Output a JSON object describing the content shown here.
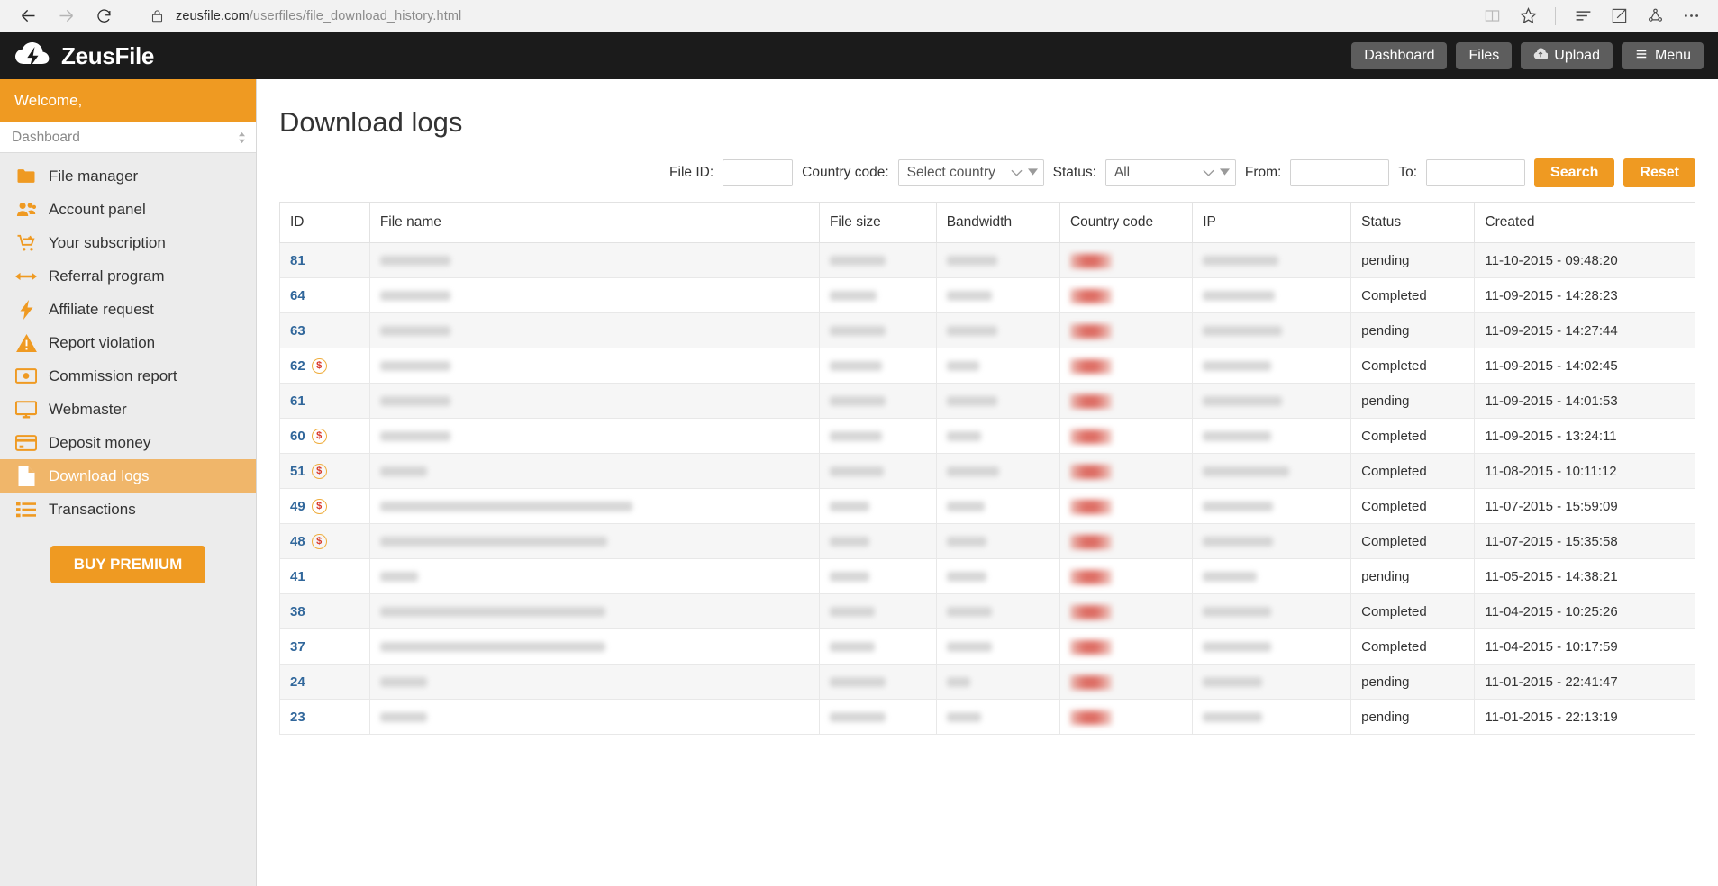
{
  "browser": {
    "url_host": "zeusfile.com",
    "url_path": "/userfiles/file_download_history.html",
    "back_icon": "back-arrow-icon",
    "forward_icon": "forward-arrow-icon",
    "refresh_icon": "refresh-icon",
    "lock_icon": "lock-icon",
    "reading_view_icon": "book-icon",
    "favorites_icon": "star-icon",
    "hub_icon": "hub-lines-icon",
    "note_icon": "note-edit-icon",
    "share_icon": "share-icon",
    "more_icon": "more-ellipsis-icon"
  },
  "header": {
    "brand": "ZeusFile",
    "logo_icon": "cloud-lightning-icon",
    "nav": [
      {
        "label": "Dashboard",
        "icon": ""
      },
      {
        "label": "Files",
        "icon": ""
      },
      {
        "label": "Upload",
        "icon": "cloud-upload-icon"
      },
      {
        "label": "Menu",
        "icon": "hamburger-icon"
      }
    ]
  },
  "sidebar": {
    "welcome": "Welcome,",
    "dashboard_select": "Dashboard",
    "items": [
      {
        "label": "File manager",
        "icon": "folder-icon",
        "active": false
      },
      {
        "label": "Account panel",
        "icon": "users-icon",
        "active": false
      },
      {
        "label": "Your subscription",
        "icon": "cart-plus-icon",
        "active": false
      },
      {
        "label": "Referral program",
        "icon": "arrows-icon",
        "active": false
      },
      {
        "label": "Affiliate request",
        "icon": "bolt-icon",
        "active": false
      },
      {
        "label": "Report violation",
        "icon": "warning-icon",
        "active": false
      },
      {
        "label": "Commission report",
        "icon": "banknote-icon",
        "active": false
      },
      {
        "label": "Webmaster",
        "icon": "monitor-icon",
        "active": false
      },
      {
        "label": "Deposit money",
        "icon": "credit-card-icon",
        "active": false
      },
      {
        "label": "Download logs",
        "icon": "document-icon",
        "active": true
      },
      {
        "label": "Transactions",
        "icon": "list-icon",
        "active": false
      }
    ],
    "buy_premium": "BUY PREMIUM"
  },
  "main": {
    "title": "Download logs",
    "filters": {
      "file_id_label": "File ID:",
      "file_id_value": "",
      "country_label": "Country code:",
      "country_value": "Select country",
      "status_label": "Status:",
      "status_value": "All",
      "from_label": "From:",
      "from_value": "",
      "to_label": "To:",
      "to_value": "",
      "search_button": "Search",
      "reset_button": "Reset"
    },
    "table": {
      "columns": [
        "ID",
        "File name",
        "File size",
        "Bandwidth",
        "Country code",
        "IP",
        "Status",
        "Created"
      ],
      "rows": [
        {
          "id": "81",
          "paid": false,
          "status": "pending",
          "created": "11-10-2015 - 09:48:20",
          "name_w": 78,
          "size_w": 62,
          "bw_w": 56,
          "ip_w": 84
        },
        {
          "id": "64",
          "paid": false,
          "status": "Completed",
          "created": "11-09-2015 - 14:28:23",
          "name_w": 78,
          "size_w": 52,
          "bw_w": 50,
          "ip_w": 80
        },
        {
          "id": "63",
          "paid": false,
          "status": "pending",
          "created": "11-09-2015 - 14:27:44",
          "name_w": 78,
          "size_w": 62,
          "bw_w": 56,
          "ip_w": 88
        },
        {
          "id": "62",
          "paid": true,
          "status": "Completed",
          "created": "11-09-2015 - 14:02:45",
          "name_w": 78,
          "size_w": 58,
          "bw_w": 36,
          "ip_w": 76
        },
        {
          "id": "61",
          "paid": false,
          "status": "pending",
          "created": "11-09-2015 - 14:01:53",
          "name_w": 78,
          "size_w": 62,
          "bw_w": 56,
          "ip_w": 88
        },
        {
          "id": "60",
          "paid": true,
          "status": "Completed",
          "created": "11-09-2015 - 13:24:11",
          "name_w": 78,
          "size_w": 58,
          "bw_w": 38,
          "ip_w": 76
        },
        {
          "id": "51",
          "paid": true,
          "status": "Completed",
          "created": "11-08-2015 - 10:11:12",
          "name_w": 52,
          "size_w": 60,
          "bw_w": 58,
          "ip_w": 96
        },
        {
          "id": "49",
          "paid": true,
          "status": "Completed",
          "created": "11-07-2015 - 15:59:09",
          "name_w": 280,
          "size_w": 44,
          "bw_w": 42,
          "ip_w": 78
        },
        {
          "id": "48",
          "paid": true,
          "status": "Completed",
          "created": "11-07-2015 - 15:35:58",
          "name_w": 252,
          "size_w": 44,
          "bw_w": 44,
          "ip_w": 78
        },
        {
          "id": "41",
          "paid": false,
          "status": "pending",
          "created": "11-05-2015 - 14:38:21",
          "name_w": 42,
          "size_w": 44,
          "bw_w": 44,
          "ip_w": 60
        },
        {
          "id": "38",
          "paid": false,
          "status": "Completed",
          "created": "11-04-2015 - 10:25:26",
          "name_w": 250,
          "size_w": 50,
          "bw_w": 50,
          "ip_w": 76
        },
        {
          "id": "37",
          "paid": false,
          "status": "Completed",
          "created": "11-04-2015 - 10:17:59",
          "name_w": 250,
          "size_w": 50,
          "bw_w": 50,
          "ip_w": 76
        },
        {
          "id": "24",
          "paid": false,
          "status": "pending",
          "created": "11-01-2015 - 22:41:47",
          "name_w": 52,
          "size_w": 62,
          "bw_w": 26,
          "ip_w": 66
        },
        {
          "id": "23",
          "paid": false,
          "status": "pending",
          "created": "11-01-2015 - 22:13:19",
          "name_w": 52,
          "size_w": 62,
          "bw_w": 38,
          "ip_w": 66
        }
      ]
    }
  },
  "colors": {
    "accent_orange": "#ef9a22",
    "active_item": "#f0b66a",
    "header_dark": "#1b1b1b",
    "link_blue": "#31679b",
    "status_pending": "#e5a427"
  }
}
